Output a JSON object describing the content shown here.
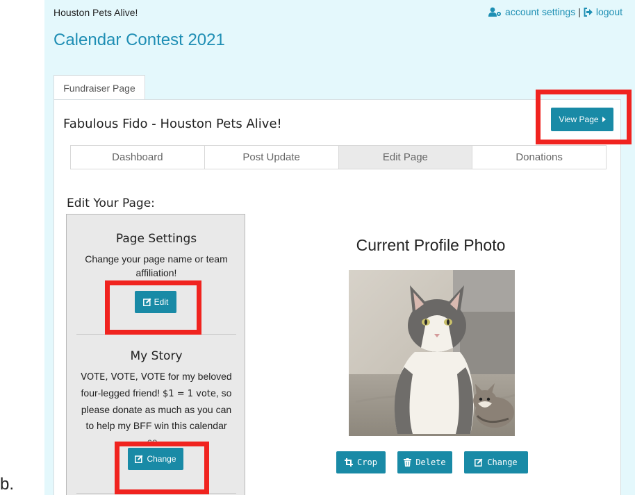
{
  "header": {
    "org_name": "Houston Pets Alive!",
    "account_settings_label": "account settings",
    "separator": "|",
    "logout_label": "logout",
    "site_title": "Calendar Contest 2021",
    "link_color": "#1d8fb3"
  },
  "tabs": {
    "fundraiser_page": "Fundraiser Page"
  },
  "campaign": {
    "title": "Fabulous Fido - Houston Pets Alive!",
    "view_page_button": "View Page"
  },
  "subnav": {
    "items": [
      "Dashboard",
      "Post Update",
      "Edit Page",
      "Donations"
    ],
    "active": "Edit Page"
  },
  "edit": {
    "heading": "Edit Your Page:",
    "page_settings": {
      "title": "Page Settings",
      "description": "Change your page name or team affiliation!",
      "edit_button": "Edit"
    },
    "story": {
      "title": "My Story",
      "vote_text": "VOTE, VOTE, VOTE",
      "text_1": " for my beloved four-legged friend! ",
      "dollar_text": "$1 = 1 vote",
      "text_2": ", so please donate as much as you can to help my BFF win this calendar co...",
      "change_button": "Change"
    }
  },
  "profile_photo": {
    "title": "Current Profile Photo",
    "crop_button": "Crop",
    "delete_button": "Delete",
    "change_button": "Change"
  },
  "annotation": {
    "step_label": "b.",
    "highlight_color": "#f0231f"
  },
  "colors": {
    "accent": "#198aa6",
    "panel_bg": "#e4f8fc"
  }
}
